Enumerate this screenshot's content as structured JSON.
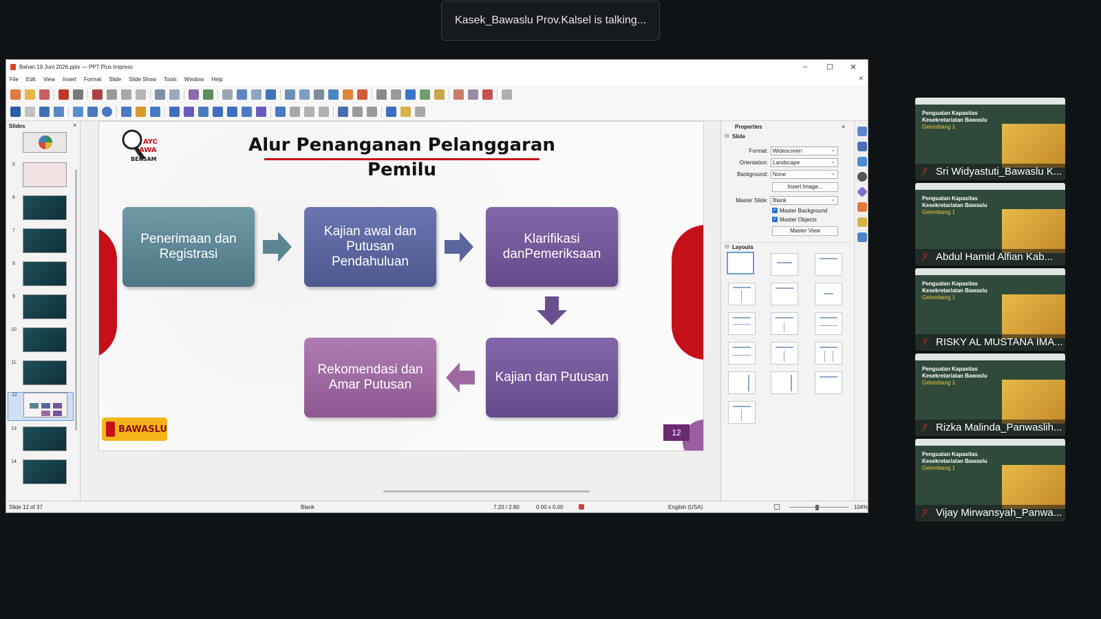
{
  "meeting": {
    "speaking_notice": "Kasek_Bawaslu Prov.Kalsel is talking..."
  },
  "window": {
    "title": "Bahan 19 Juni 2026.pptx — PPT Plus Impress",
    "menu": [
      "File",
      "Edit",
      "View",
      "Insert",
      "Format",
      "Slide",
      "Slide Show",
      "Tools",
      "Window",
      "Help"
    ]
  },
  "slides_pane": {
    "header": "Slides",
    "slide_numbers": [
      "5",
      "6",
      "7",
      "8",
      "9",
      "10",
      "11",
      "12",
      "13",
      "14"
    ],
    "selected": "12"
  },
  "slide": {
    "title": "Alur Penanganan Pelanggaran Pemilu",
    "logo_text": "AYO AWASI BERSAMA",
    "steps": [
      "Penerimaan dan Registrasi",
      "Kajian awal dan Putusan Pendahuluan",
      "Klarifikasi danPemeriksaan",
      "Kajian dan Putusan",
      "Rekomendasi dan Amar Putusan"
    ],
    "footer_logo": "BAWASLU",
    "page_number": "12"
  },
  "properties": {
    "header": "Properties",
    "section_slide": "Slide",
    "format_label": "Format:",
    "format_value": "Widescreen",
    "orientation_label": "Orientation:",
    "orientation_value": "Landscape",
    "background_label": "Background:",
    "background_value": "None",
    "insert_image": "Insert Image...",
    "master_slide_label": "Master Slide:",
    "master_slide_value": "Blank",
    "master_background": "Master Background",
    "master_objects": "Master Objects",
    "master_view": "Master View",
    "section_layouts": "Layouts"
  },
  "status": {
    "slide_of": "Slide 12 of 37",
    "master": "Blank",
    "position": "7.20 / 2.80",
    "size": "0.00 x 0.00",
    "language": "English (USA)",
    "zoom": "104%"
  },
  "participants": [
    {
      "name": "Sri Widyastuti_Bawaslu K..."
    },
    {
      "name": "Abdul Hamid Alfian Kab..."
    },
    {
      "name": "RISKY AL MUSTANA IMA..."
    },
    {
      "name": "Rizka Malinda_Panwaslih..."
    },
    {
      "name": "Vijay Mirwansyah_Panwa..."
    }
  ],
  "participant_tile": {
    "title": "Penguatan Kapasitas Kesekretariatan Bawaslu",
    "subtitle": "Gelombang 1"
  },
  "colors": {
    "accent_red": "#c5101a",
    "box_teal": "#5b8593",
    "box_indigo": "#5b659f",
    "box_purple": "#745799",
    "box_pink": "#9e69a1"
  }
}
